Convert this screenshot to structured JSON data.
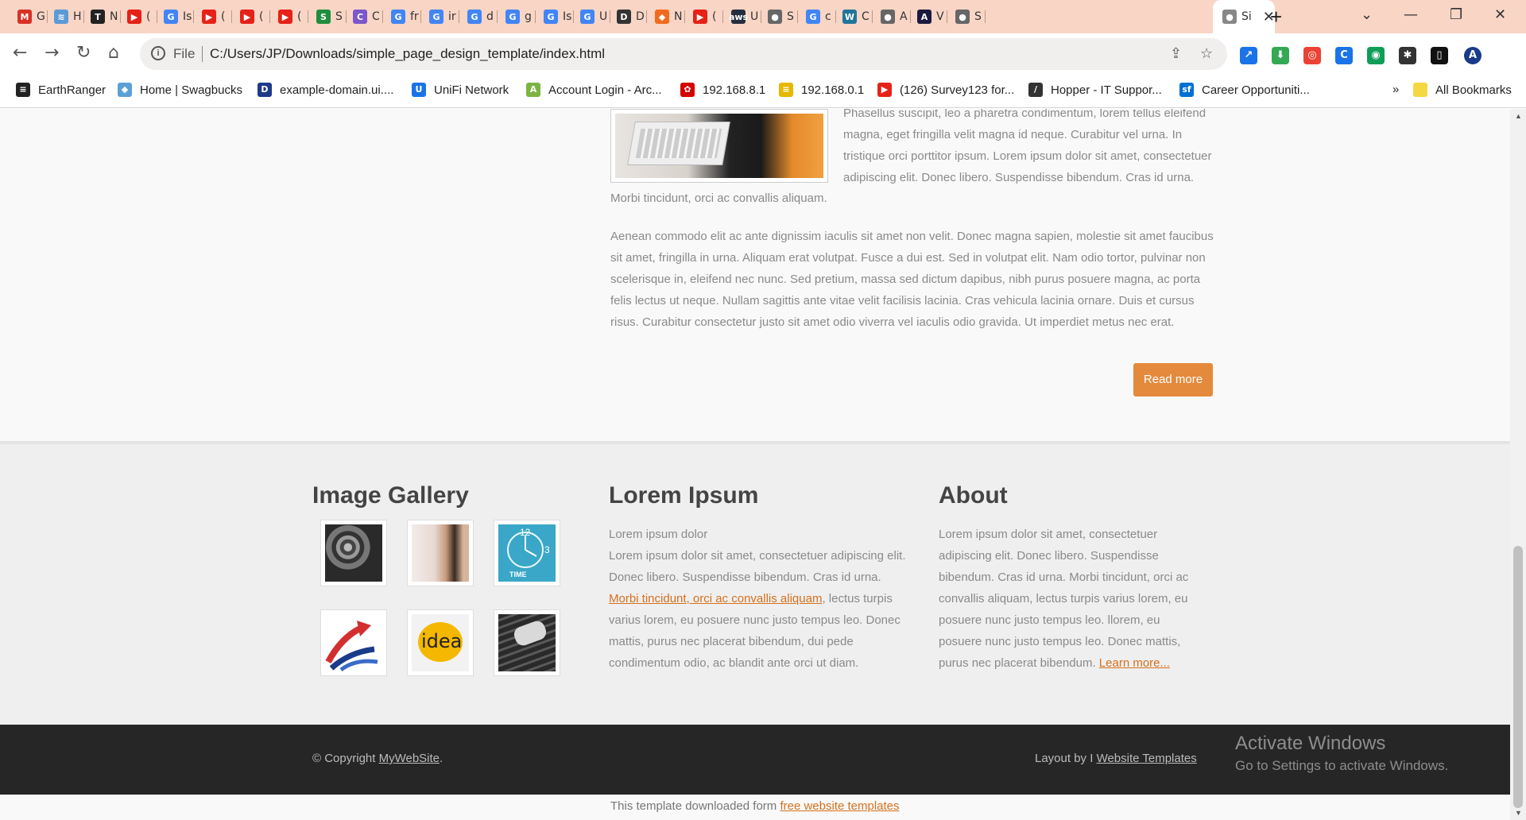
{
  "browser": {
    "tabs": [
      {
        "fav": "M",
        "color": "#d93025",
        "label": "G"
      },
      {
        "fav": "≋",
        "color": "#5a9bd5",
        "label": "H"
      },
      {
        "fav": "T",
        "color": "#222222",
        "label": "N"
      },
      {
        "fav": "▶",
        "color": "#e62117",
        "label": "("
      },
      {
        "fav": "G",
        "color": "#4285f4",
        "label": "Is"
      },
      {
        "fav": "▶",
        "color": "#e62117",
        "label": "("
      },
      {
        "fav": "▶",
        "color": "#e62117",
        "label": "("
      },
      {
        "fav": "▶",
        "color": "#e62117",
        "label": "("
      },
      {
        "fav": "S",
        "color": "#1e8e3e",
        "label": "S"
      },
      {
        "fav": "C",
        "color": "#7b57c9",
        "label": "C"
      },
      {
        "fav": "G",
        "color": "#4285f4",
        "label": "fr"
      },
      {
        "fav": "G",
        "color": "#4285f4",
        "label": "ir"
      },
      {
        "fav": "G",
        "color": "#4285f4",
        "label": "d"
      },
      {
        "fav": "G",
        "color": "#4285f4",
        "label": "g"
      },
      {
        "fav": "G",
        "color": "#4285f4",
        "label": "Is"
      },
      {
        "fav": "G",
        "color": "#4285f4",
        "label": "U"
      },
      {
        "fav": "D",
        "color": "#333333",
        "label": "D"
      },
      {
        "fav": "◆",
        "color": "#f26b1d",
        "label": "N"
      },
      {
        "fav": "▶",
        "color": "#e62117",
        "label": "("
      },
      {
        "fav": "aws",
        "color": "#232f3e",
        "label": "U"
      },
      {
        "fav": "●",
        "color": "#666666",
        "label": "S"
      },
      {
        "fav": "G",
        "color": "#4285f4",
        "label": "c"
      },
      {
        "fav": "W",
        "color": "#21759b",
        "label": "C"
      },
      {
        "fav": "●",
        "color": "#666666",
        "label": "A"
      },
      {
        "fav": "A",
        "color": "#1a1a40",
        "label": "V"
      },
      {
        "fav": "●",
        "color": "#666666",
        "label": "S"
      }
    ],
    "active_tab": {
      "label": "Si"
    },
    "new_tab": "+",
    "window_controls": {
      "search_tabs": "⌄",
      "minimize": "—",
      "restore": "❐",
      "close": "✕"
    },
    "address": {
      "scheme": "File",
      "url": "C:/Users/JP/Downloads/simple_page_design_template/index.html"
    },
    "extensions": [
      {
        "glyph": "↗",
        "color": "#1a73e8"
      },
      {
        "glyph": "⬇",
        "color": "#34a853"
      },
      {
        "glyph": "◎",
        "color": "#ea4335"
      },
      {
        "glyph": "C",
        "color": "#1a73e8"
      },
      {
        "glyph": "◉",
        "color": "#0f9d58"
      },
      {
        "glyph": "✱",
        "color": "#333333"
      },
      {
        "glyph": "▯",
        "color": "#111111"
      },
      {
        "glyph": "A",
        "color": "#1a3b8a"
      }
    ],
    "bookmarks": [
      {
        "label": "EarthRanger",
        "glyph": "≡",
        "color": "#222222"
      },
      {
        "label": "Home | Swagbucks",
        "glyph": "◆",
        "color": "#5aa0d8"
      },
      {
        "label": "example-domain.ui....",
        "glyph": "D",
        "color": "#1e3a8a"
      },
      {
        "label": "UniFi Network",
        "glyph": "U",
        "color": "#1a73e8"
      },
      {
        "label": "Account Login - Arc...",
        "glyph": "A",
        "color": "#7cb342"
      },
      {
        "label": "192.168.8.1",
        "glyph": "✿",
        "color": "#d50000"
      },
      {
        "label": "192.168.0.1",
        "glyph": "≡",
        "color": "#e6b800"
      },
      {
        "label": "(126) Survey123 for...",
        "glyph": "▶",
        "color": "#e62117"
      },
      {
        "label": "Hopper - IT Suppor...",
        "glyph": "/",
        "color": "#333333"
      },
      {
        "label": "Career Opportuniti...",
        "glyph": "sf",
        "color": "#0070d2"
      }
    ],
    "bookmarks_more": "»",
    "all_bookmarks": "All Bookmarks"
  },
  "article": {
    "para1_lines": [
      "Phasellus suscipit, leo a pharetra condimentum, lorem tellus eleifend",
      "magna, eget fringilla velit magna id neque. Curabitur vel urna. In",
      "tristique orci porttitor ipsum. Lorem ipsum dolor sit amet, consectetuer",
      "adipiscing elit. Donec libero. Suspendisse bibendum. Cras id urna."
    ],
    "para1_tail": "Morbi tincidunt, orci ac convallis aliquam.",
    "para2": "Aenean commodo elit ac ante dignissim iaculis sit amet non velit. Donec magna sapien, molestie sit amet faucibus sit amet, fringilla in urna. Aliquam erat volutpat. Fusce a dui est. Sed in volutpat elit. Nam odio tortor, pulvinar non scelerisque in, eleifend nec nunc. Sed pretium, massa sed dictum dapibus, nibh purus posuere magna, ac porta felis lectus ut neque. Nullam sagittis ante vitae velit facilisis lacinia. Cras vehicula lacinia ornare. Duis et cursus risus. Curabitur consectetur justo sit amet odio viverra vel iaculis odio gravida. Ut imperdiet metus nec erat.",
    "read_more": "Read more"
  },
  "footer": {
    "gallery_title": "Image Gallery",
    "lorem_title": "Lorem Ipsum",
    "lorem_intro": "Lorem ipsum dolor",
    "lorem_text_a": "Lorem ipsum dolor sit amet, consectetuer adipiscing elit. Donec libero. Suspendisse bibendum. Cras id urna.",
    "lorem_link": "Morbi tincidunt, orci ac convallis aliquam",
    "lorem_text_b": ", lectus turpis varius lorem, eu posuere nunc justo tempus leo. Donec mattis, purus nec placerat bibendum, dui pede condimentum odio, ac blandit ante orci ut diam.",
    "about_title": "About",
    "about_text": "Lorem ipsum dolor sit amet, consectetuer adipiscing elit. Donec libero. Suspendisse bibendum. Cras id urna. Morbi tincidunt, orci ac convallis aliquam, lectus turpis varius lorem, eu posuere nunc justo tempus leo. llorem, eu posuere nunc justo tempus leo. Donec mattis, purus nec placerat bibendum.",
    "about_link": "Learn more...",
    "gallery_thumbs": [
      "swirl",
      "headphones",
      "clock",
      "arrows",
      "idea",
      "keyboard"
    ],
    "clock_text": "TIME",
    "idea_text": "idea"
  },
  "bottom": {
    "copyright_prefix": "© Copyright ",
    "copyright_link": "MyWebSite",
    "copyright_suffix": ".",
    "layout_prefix": "Layout by I ",
    "layout_link": "Website Templates",
    "activate_title": "Activate Windows",
    "activate_sub": "Go to Settings to activate Windows.",
    "credit_prefix": "This template downloaded form ",
    "credit_link": "free website templates"
  },
  "colors": {
    "accent": "#e48a3c",
    "link": "#d4701e",
    "tabstrip": "#f9d5c5",
    "footer_dark": "#262626"
  }
}
